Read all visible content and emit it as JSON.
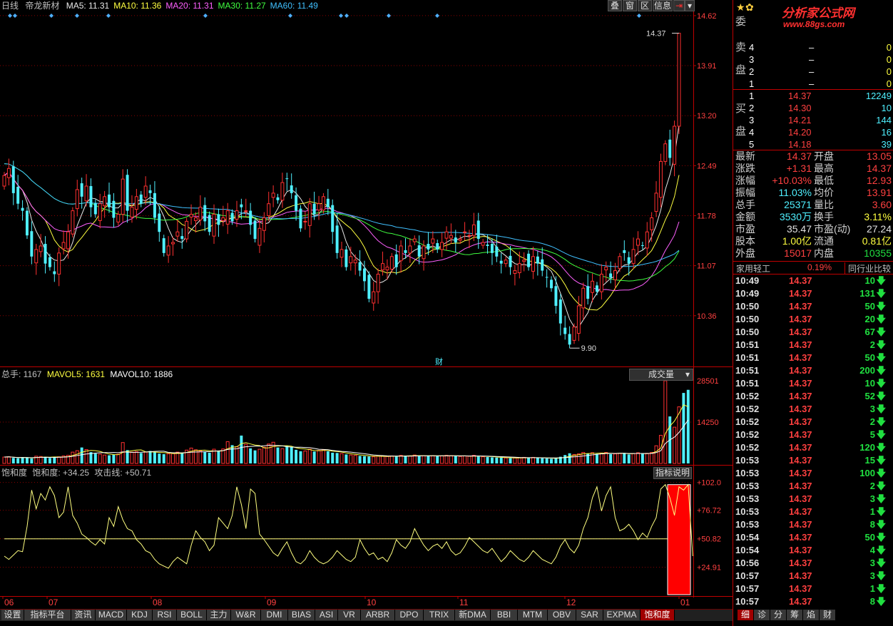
{
  "header": {
    "period": "日线",
    "name": "帝龙新材",
    "ma": [
      {
        "label": "MA5: 11.31",
        "color": "#e8e8e8"
      },
      {
        "label": "MA10: 11.36",
        "color": "#ffff40"
      },
      {
        "label": "MA20: 11.31",
        "color": "#ff60ff"
      },
      {
        "label": "MA30: 11.27",
        "color": "#40ff40"
      },
      {
        "label": "MA60: 11.49",
        "color": "#40c0ff"
      }
    ],
    "buttons": [
      "叠",
      "窗",
      "区",
      "信息"
    ]
  },
  "price_axis": [
    "14.62",
    "13.91",
    "13.20",
    "12.49",
    "11.78",
    "11.07",
    "10.36"
  ],
  "annotations": {
    "high": "14.37",
    "low": "9.90",
    "cai": "财"
  },
  "volume_header": {
    "total": "总手: 1167",
    "mavol5": "MAVOL5: 1631",
    "mavol10": "MAVOL10: 1886",
    "dropdown": "成交量"
  },
  "volume_axis": [
    "28501",
    "14250"
  ],
  "indicator_header": {
    "name": "饱和度",
    "value": "饱和度: +34.25",
    "attack": "攻击线: +50.71",
    "button": "指标说明"
  },
  "indicator_axis": [
    "+102.0",
    "+76.72",
    "+50.82",
    "+24.91"
  ],
  "date_axis": [
    "06",
    "07",
    "08",
    "09",
    "10",
    "11",
    "12",
    "01"
  ],
  "tabs": [
    "设置",
    "指标平台",
    "资讯",
    "MACD",
    "KDJ",
    "RSI",
    "BOLL",
    "主力",
    "W&R",
    "DMI",
    "BIAS",
    "ASI",
    "VR",
    "ARBR",
    "DPO",
    "TRIX",
    "新DMA",
    "BBI",
    "MTM",
    "OBV",
    "SAR",
    "EXPMA",
    "饱和度"
  ],
  "active_tab": "饱和度",
  "panel": {
    "logo": "分析家公式网",
    "logo_url": "www.88gs.com",
    "wei_label": "委",
    "sell_label_1": "卖",
    "sell_label_2": "盘",
    "buy_label_1": "买",
    "buy_label_2": "盘",
    "sell": [
      {
        "lvl": "4",
        "price": "–",
        "vol": "0"
      },
      {
        "lvl": "3",
        "price": "–",
        "vol": "0"
      },
      {
        "lvl": "2",
        "price": "–",
        "vol": "0"
      },
      {
        "lvl": "1",
        "price": "–",
        "vol": "0"
      }
    ],
    "buy": [
      {
        "lvl": "1",
        "price": "14.37",
        "vol": "12249"
      },
      {
        "lvl": "2",
        "price": "14.30",
        "vol": "10"
      },
      {
        "lvl": "3",
        "price": "14.21",
        "vol": "144"
      },
      {
        "lvl": "4",
        "price": "14.20",
        "vol": "16"
      },
      {
        "lvl": "5",
        "price": "14.18",
        "vol": "39"
      }
    ],
    "stats": [
      {
        "k1": "最新",
        "v1": "14.37",
        "c1": "#ff4040",
        "k2": "开盘",
        "v2": "13.05",
        "c2": "#ff4040"
      },
      {
        "k1": "涨跌",
        "v1": "+1.31",
        "c1": "#ff4040",
        "k2": "最高",
        "v2": "14.37",
        "c2": "#ff4040"
      },
      {
        "k1": "涨幅",
        "v1": "+10.03%",
        "c1": "#ff4040",
        "k2": "最低",
        "v2": "12.93",
        "c2": "#ff4040"
      },
      {
        "k1": "振幅",
        "v1": "11.03%",
        "c1": "#4ff0ff",
        "k2": "均价",
        "v2": "13.91",
        "c2": "#ff4040"
      },
      {
        "k1": "总手",
        "v1": "25371",
        "c1": "#4ff0ff",
        "k2": "量比",
        "v2": "3.60",
        "c2": "#ff4040"
      },
      {
        "k1": "金额",
        "v1": "3530万",
        "c1": "#4ff0ff",
        "k2": "换手",
        "v2": "3.11%",
        "c2": "#ffff40"
      },
      {
        "k1": "市盈",
        "v1": "35.47",
        "c1": "#e0e0e0",
        "k2": "市盈(动)",
        "v2": "27.24",
        "c2": "#e0e0e0"
      },
      {
        "k1": "股本",
        "v1": "1.00亿",
        "c1": "#ffff40",
        "k2": "流通",
        "v2": "0.81亿",
        "c2": "#ffff40"
      },
      {
        "k1": "外盘",
        "v1": "15017",
        "c1": "#ff4040",
        "k2": "内盘",
        "v2": "10355",
        "c2": "#20e040"
      }
    ],
    "industry": {
      "name": "家用轻工",
      "pct": "0.19%",
      "compare": "同行业比较"
    },
    "ticks": [
      {
        "t": "10:49",
        "p": "14.37",
        "v": "10"
      },
      {
        "t": "10:49",
        "p": "14.37",
        "v": "131"
      },
      {
        "t": "10:50",
        "p": "14.37",
        "v": "50"
      },
      {
        "t": "10:50",
        "p": "14.37",
        "v": "20"
      },
      {
        "t": "10:50",
        "p": "14.37",
        "v": "67"
      },
      {
        "t": "10:51",
        "p": "14.37",
        "v": "2"
      },
      {
        "t": "10:51",
        "p": "14.37",
        "v": "50"
      },
      {
        "t": "10:51",
        "p": "14.37",
        "v": "200"
      },
      {
        "t": "10:51",
        "p": "14.37",
        "v": "10"
      },
      {
        "t": "10:52",
        "p": "14.37",
        "v": "52"
      },
      {
        "t": "10:52",
        "p": "14.37",
        "v": "3"
      },
      {
        "t": "10:52",
        "p": "14.37",
        "v": "2"
      },
      {
        "t": "10:52",
        "p": "14.37",
        "v": "5"
      },
      {
        "t": "10:52",
        "p": "14.37",
        "v": "120"
      },
      {
        "t": "10:53",
        "p": "14.37",
        "v": "15"
      },
      {
        "t": "10:53",
        "p": "14.37",
        "v": "100"
      },
      {
        "t": "10:53",
        "p": "14.37",
        "v": "2"
      },
      {
        "t": "10:53",
        "p": "14.37",
        "v": "3"
      },
      {
        "t": "10:53",
        "p": "14.37",
        "v": "1"
      },
      {
        "t": "10:53",
        "p": "14.37",
        "v": "8"
      },
      {
        "t": "10:54",
        "p": "14.37",
        "v": "50"
      },
      {
        "t": "10:54",
        "p": "14.37",
        "v": "4"
      },
      {
        "t": "10:56",
        "p": "14.37",
        "v": "3"
      },
      {
        "t": "10:57",
        "p": "14.37",
        "v": "3"
      },
      {
        "t": "10:57",
        "p": "14.37",
        "v": "1"
      },
      {
        "t": "10:57",
        "p": "14.37",
        "v": "8"
      }
    ],
    "bottom_tabs": [
      "细",
      "诊",
      "分",
      "筹",
      "焰",
      "财"
    ]
  },
  "colors": {
    "up": "#ff3030",
    "down": "#4ff0ff",
    "grid": "#8b0000",
    "axis": "#c00000",
    "ma5": "#e8e8e8",
    "ma10": "#ffff40",
    "ma20": "#ff60ff",
    "ma30": "#40ff40",
    "ma60": "#40c0ff",
    "indicator": "#ffff80"
  },
  "chart_data": {
    "type": "candlestick",
    "y_range": [
      9.7,
      14.7
    ],
    "high_marker": 14.37,
    "low_marker": 9.9,
    "closes": [
      12.35,
      12.45,
      12.1,
      11.95,
      11.85,
      11.5,
      11.2,
      11.3,
      11.35,
      11.1,
      11.05,
      10.95,
      11.25,
      11.4,
      11.55,
      11.85,
      12.15,
      12.05,
      12.2,
      11.9,
      11.8,
      11.95,
      12.05,
      11.9,
      11.75,
      11.8,
      12.3,
      11.85,
      11.9,
      12.05,
      11.95,
      12.2,
      12.1,
      11.75,
      11.55,
      11.25,
      11.35,
      11.4,
      11.55,
      11.45,
      11.7,
      11.8,
      11.75,
      11.9,
      11.7,
      11.55,
      11.8,
      11.65,
      11.75,
      11.85,
      11.7,
      11.85,
      11.9,
      11.85,
      11.65,
      11.45,
      11.6,
      11.75,
      11.95,
      12.1,
      12.0,
      12.25,
      12.3,
      12.1,
      11.85,
      11.6,
      11.7,
      11.95,
      11.8,
      11.95,
      12.05,
      11.9,
      11.55,
      11.25,
      11.3,
      11.05,
      11.2,
      11.15,
      11.0,
      10.85,
      10.6,
      10.7,
      10.95,
      11.1,
      11.05,
      11.2,
      11.05,
      11.35,
      11.25,
      11.35,
      11.45,
      11.2,
      11.35,
      11.3,
      11.45,
      11.3,
      11.4,
      11.55,
      11.5,
      11.4,
      11.45,
      11.55,
      11.5,
      11.65,
      11.45,
      11.4,
      11.35,
      11.25,
      11.2,
      11.1,
      11.15,
      11.05,
      11.0,
      11.1,
      11.15,
      11.05,
      11.2,
      11.1,
      11.0,
      10.9,
      10.75,
      10.5,
      10.25,
      10.1,
      9.95,
      10.2,
      10.5,
      10.75,
      10.6,
      10.85,
      10.7,
      10.95,
      11.05,
      10.9,
      11.0,
      11.2,
      11.25,
      11.1,
      11.3,
      11.45,
      11.35,
      11.55,
      11.75,
      12.1,
      12.55,
      12.8,
      12.6,
      13.05,
      14.37
    ],
    "volumes": [
      2200,
      2300,
      1900,
      1800,
      2100,
      2000,
      1700,
      2500,
      2400,
      2300,
      1900,
      2100,
      2300,
      2600,
      2800,
      3900,
      4400,
      5500,
      4800,
      3900,
      3400,
      3200,
      2900,
      2800,
      3000,
      3200,
      7200,
      4600,
      3900,
      4100,
      3600,
      3900,
      4300,
      3800,
      3400,
      3200,
      3300,
      3400,
      3900,
      3700,
      4600,
      5300,
      4700,
      4300,
      3900,
      3700,
      4900,
      4200,
      5000,
      7500,
      6300,
      5800,
      9600,
      6600,
      5200,
      4500,
      4900,
      5600,
      6700,
      7300,
      5500,
      5100,
      6000,
      5700,
      4700,
      4200,
      4300,
      4900,
      4100,
      4500,
      4700,
      4200,
      3700,
      3600,
      3400,
      3100,
      2900,
      2800,
      2600,
      2500,
      2400,
      2300,
      2500,
      2600,
      2400,
      2600,
      2400,
      2800,
      2700,
      2600,
      2900,
      2500,
      2700,
      2600,
      2700,
      2500,
      2600,
      2800,
      2700,
      2500,
      2400,
      2600,
      2500,
      2800,
      2400,
      2300,
      2200,
      2100,
      2000,
      2000,
      1900,
      1800,
      1900,
      2000,
      2100,
      1900,
      2100,
      1900,
      1800,
      1700,
      1600,
      1900,
      2300,
      2900,
      3500,
      3100,
      3300,
      3800,
      3400,
      3700,
      3300,
      3600,
      3800,
      3200,
      3300,
      3500,
      3600,
      3100,
      3400,
      3700,
      3300,
      3500,
      3800,
      6100,
      9700,
      28500,
      16200,
      12500,
      19500,
      24300,
      25371
    ],
    "indicator_range": [
      0,
      105
    ],
    "indicator": [
      35,
      32,
      36,
      40,
      39,
      62,
      95,
      78,
      92,
      86,
      98,
      90,
      70,
      75,
      98,
      72,
      65,
      55,
      52,
      48,
      45,
      50,
      46,
      70,
      62,
      80,
      68,
      60,
      58,
      50,
      46,
      40,
      38,
      32,
      28,
      26,
      24,
      30,
      34,
      31,
      28,
      45,
      58,
      52,
      48,
      40,
      45,
      70,
      65,
      60,
      72,
      98,
      82,
      60,
      96,
      92,
      55,
      50,
      44,
      38,
      35,
      42,
      48,
      38,
      30,
      28,
      32,
      40,
      34,
      30,
      28,
      30,
      34,
      40,
      36,
      32,
      30,
      34,
      50,
      42,
      36,
      38,
      32,
      34,
      30,
      38,
      50,
      45,
      42,
      48,
      60,
      52,
      45,
      40,
      44,
      46,
      42,
      48,
      40,
      36,
      38,
      44,
      52,
      48,
      44,
      40,
      38,
      42,
      36,
      30,
      34,
      40,
      36,
      32,
      30,
      34,
      40,
      36,
      32,
      30,
      28,
      34,
      44,
      50,
      42,
      38,
      45,
      60,
      70,
      88,
      98,
      76,
      90,
      98,
      70,
      58,
      60,
      64,
      58,
      50,
      56,
      52,
      62,
      70,
      96,
      100,
      88,
      72,
      98,
      95,
      100,
      35
    ]
  }
}
